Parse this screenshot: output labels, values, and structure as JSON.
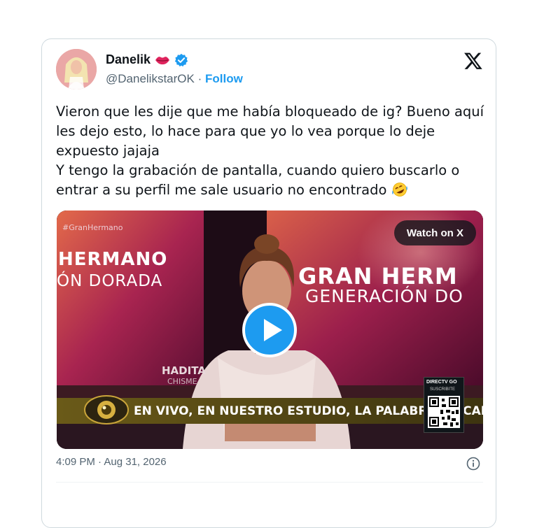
{
  "author": {
    "name": "Danelik",
    "handle": "@DanelikstarOK",
    "separator": "·",
    "follow_label": "Follow"
  },
  "tweet": {
    "text": "Vieron que les dije que me había bloqueado de ig? Bueno aquí les dejo esto, lo hace para que yo lo vea porque lo deje expuesto jajaja\nY tengo la grabación de pantalla, cuando quiero buscarlo o entrar a su perfil me sale usuario no encontrado ",
    "emoji_icon": "rolling-on-floor-laughing-icon"
  },
  "media": {
    "watch_label": "Watch on X",
    "hashtag": "#GranHermano",
    "brand_left_line1": "HERMANO",
    "brand_left_line2": "ÓN DORADA",
    "brand_right_line1": "GRAN HERM",
    "brand_right_line2": "GENERACIÓN DO",
    "watermark_line1": "HADITA",
    "watermark_line2": "CHISME",
    "ticker": "EN VIVO, EN NUESTRO ESTUDIO, LA PALABRA DE CAM",
    "qr_label_1": "DIRECTV GO",
    "qr_label_2": "SUSCRIBITE"
  },
  "meta": {
    "timestamp": "4:09 PM · Aug 31, 2026"
  },
  "colors": {
    "link": "#1d9bf0",
    "text": "#0f1419",
    "secondary": "#536471"
  }
}
